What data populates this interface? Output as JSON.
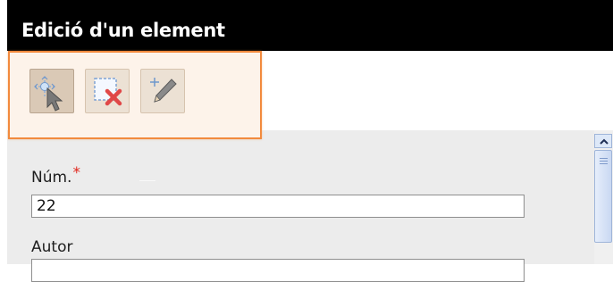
{
  "window": {
    "title": "Edició d'un element"
  },
  "toolbar": {
    "buttons": [
      {
        "name": "select-element",
        "icon": "select-arrow-icon",
        "pressed": true
      },
      {
        "name": "delete-element",
        "icon": "delete-selection-icon",
        "pressed": false
      },
      {
        "name": "edit-element",
        "icon": "pencil-add-icon",
        "pressed": false
      }
    ],
    "highlight_color": "#f28a3d"
  },
  "form": {
    "fields": [
      {
        "label": "Núm.",
        "required": true,
        "required_mark": "*",
        "value": "22"
      },
      {
        "label": "Autor",
        "required": false,
        "value": ""
      }
    ]
  },
  "colors": {
    "title_bar": "#000000",
    "title_text": "#ffffff",
    "required": "#e0261c",
    "panel_bg": "#ececec"
  }
}
